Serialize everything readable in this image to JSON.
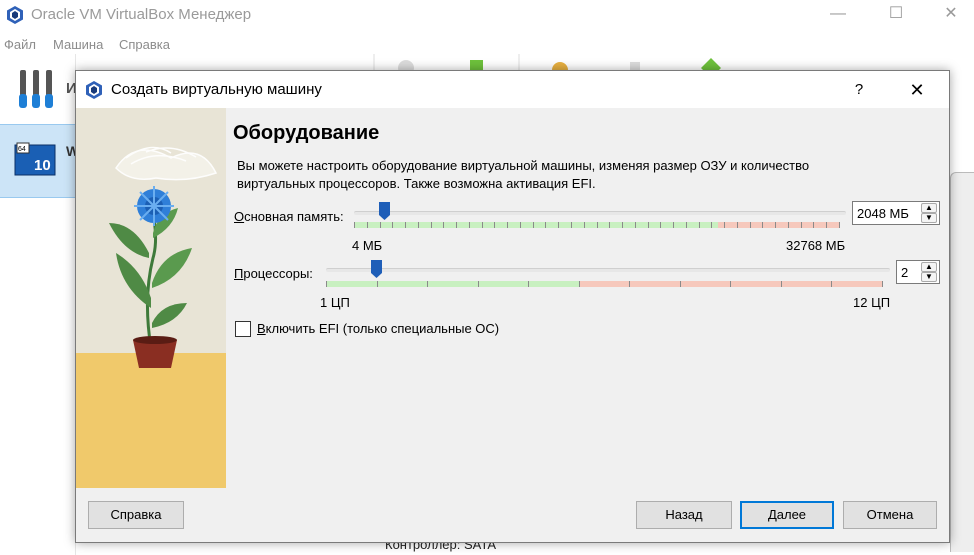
{
  "app": {
    "title": "Oracle VM VirtualBox Менеджер",
    "menu": [
      "Файл",
      "Машина",
      "Справка"
    ],
    "window_controls": {
      "minimize": "—",
      "maximize": "☐",
      "close": "✕"
    },
    "tools_label": "И",
    "vm_item_label": "W",
    "vm_badge_top": "64",
    "vm_badge_num": "10",
    "footer_text": "Контроллер: SATA"
  },
  "dialog": {
    "title": "Создать виртуальную машину",
    "help_glyph": "?",
    "close_glyph": "✕",
    "heading": "Оборудование",
    "description": "Вы можете настроить оборудование виртуальной машины, изменяя размер ОЗУ и количество виртуальных процессоров. Также возможна активация EFI.",
    "memory": {
      "label_pre": "",
      "label_ul": "О",
      "label_post": "сновная память:",
      "value": "2048 МБ",
      "min_label": "4 МБ",
      "max_label": "32768 МБ",
      "position_fraction": 0.062
    },
    "cpu": {
      "label_ul": "П",
      "label_post": "роцессоры:",
      "value": "2",
      "min_label": "1 ЦП",
      "max_label": "12 ЦП",
      "position_fraction": 0.09
    },
    "efi": {
      "label_ul": "В",
      "label_post": "ключить EFI (только специальные ОС)",
      "checked": false
    },
    "buttons": {
      "help": "Справка",
      "back": "Назад",
      "next": "Далее",
      "cancel": "Отмена"
    },
    "colors": {
      "accent": "#0078d7",
      "range_ok": "#c8f0c0",
      "range_bad": "#f6c8bc",
      "handle": "#1e5eb8"
    }
  }
}
